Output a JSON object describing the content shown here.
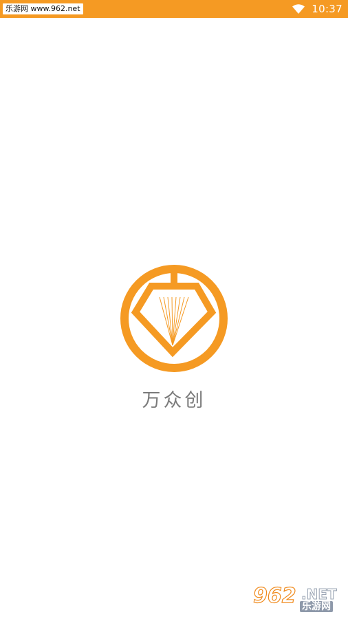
{
  "status_bar": {
    "site_badge": "乐游网 www.962.net",
    "time": "10:37",
    "background_color": "#f59a23"
  },
  "splash": {
    "logo_icon": "diamond-circle-logo-icon",
    "logo_color": "#f59a23",
    "brand_name": "万众创",
    "brand_color": "#7a7a7a"
  },
  "watermark": {
    "number": "962",
    "domain": ".NET",
    "chinese": "乐游网"
  }
}
